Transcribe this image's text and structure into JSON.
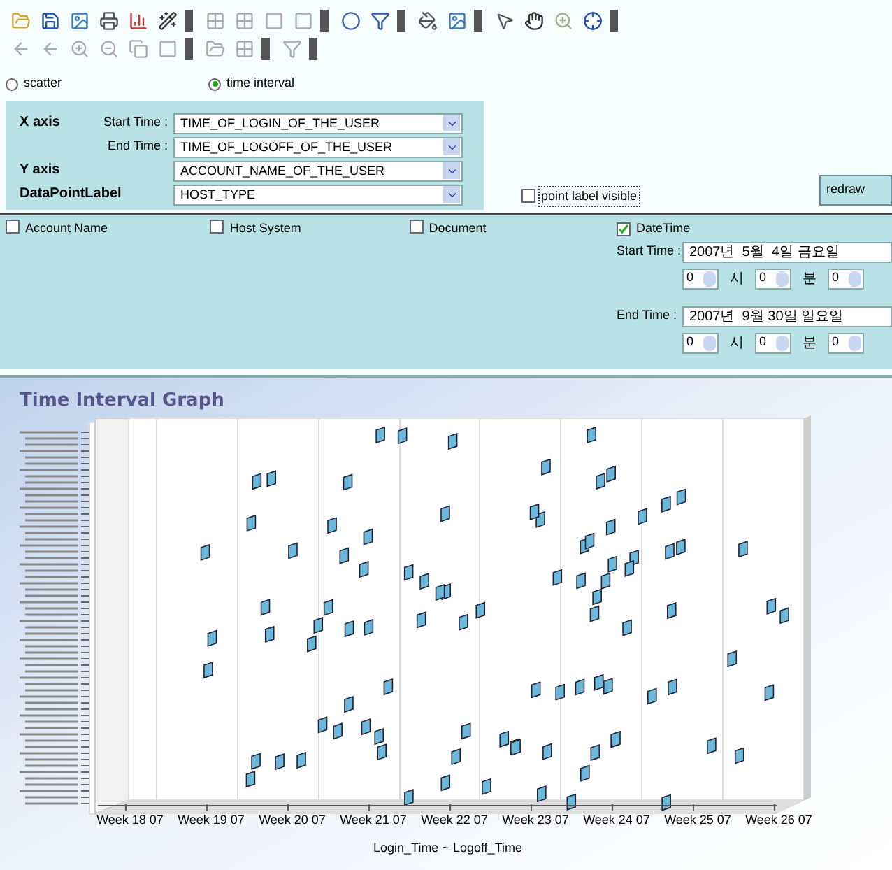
{
  "chart_type_options": [
    {
      "label": "scatter",
      "selected": false
    },
    {
      "label": "time interval",
      "selected": true
    }
  ],
  "axis_settings": [
    {
      "group": "X axis",
      "label": "Start Time :",
      "value": "TIME_OF_LOGIN_OF_THE_USER"
    },
    {
      "label": "End Time :",
      "value": "TIME_OF_LOGOFF_OF_THE_USER"
    },
    {
      "group": "Y axis",
      "value": "ACCOUNT_NAME_OF_THE_USER"
    },
    {
      "group": "DataPointLabel",
      "value": "HOST_TYPE"
    }
  ],
  "point_label_visible": {
    "label": "point label visible",
    "checked": false
  },
  "redraw_button": "redraw",
  "filters": [
    {
      "label": "Account Name",
      "checked": false
    },
    {
      "label": "Host System",
      "checked": false
    },
    {
      "label": "Document",
      "checked": false
    },
    {
      "label": "DateTime",
      "checked": true
    }
  ],
  "date_range": [
    {
      "label": "Start Time :",
      "date": "2007년  5월  4일 금요일",
      "hour": "0",
      "hour_unit": "시",
      "minute": "0",
      "minute_unit": "분",
      "second": "0"
    },
    {
      "label": "End Time :",
      "date": "2007년  9월 30일 일요일",
      "hour": "0",
      "hour_unit": "시",
      "minute": "0",
      "minute_unit": "분",
      "second": "0"
    }
  ],
  "graph": {
    "title": "Time Interval Graph",
    "x_tick_labels": [
      "Week 18 07",
      "Week 19 07",
      "Week 20 07",
      "Week 21 07",
      "Week 22 07",
      "Week 23 07",
      "Week 24 07",
      "Week 25 07",
      "Week 26 07"
    ],
    "x_axis_title": "Login_Time ~ Logoff_Time"
  }
}
